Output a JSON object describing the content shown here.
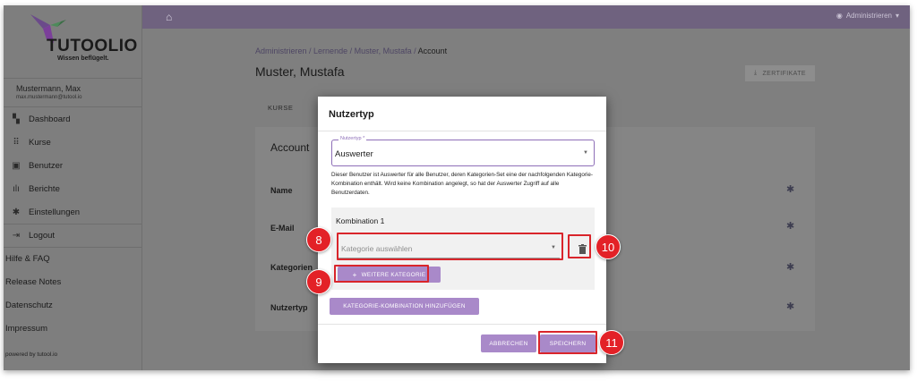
{
  "brand": {
    "name": "TUTOOLIO",
    "tagline": "Wissen beflügelt."
  },
  "user": {
    "name": "Mustermann, Max",
    "email": "max.mustermann@tutool.io"
  },
  "nav": [
    {
      "label": "Dashboard",
      "icon": "dashboard-icon"
    },
    {
      "label": "Kurse",
      "icon": "grid-icon"
    },
    {
      "label": "Benutzer",
      "icon": "user-icon"
    },
    {
      "label": "Berichte",
      "icon": "bar-chart-icon"
    },
    {
      "label": "Einstellungen",
      "icon": "gear-icon"
    },
    {
      "label": "Logout",
      "icon": "logout-icon"
    }
  ],
  "links": [
    "Hilfe & FAQ",
    "Release Notes",
    "Datenschutz",
    "Impressum"
  ],
  "powered": "powered by tutool.io",
  "topbar": {
    "admin_label": "Administrieren"
  },
  "breadcrumb": {
    "items": [
      "Administrieren",
      "Lernende",
      "Muster, Mustafa"
    ],
    "current": "Account"
  },
  "page_title": "Muster, Mustafa",
  "certificates_label": "ZERTIFIKATE",
  "tabs": [
    "KURSE"
  ],
  "account": {
    "title": "Account",
    "rows": [
      "Name",
      "E-Mail",
      "Kategorien",
      "Nutzertyp"
    ]
  },
  "dialog": {
    "title": "Nutzertyp",
    "select_label": "Nutzertyp *",
    "select_value": "Auswerter",
    "hint": "Dieser Benutzer ist Auswerter für alle Benutzer, deren Kategorien-Set eine der nachfolgenden Kategorie-Kombination enthält. Wird keine Kombination angelegt, so hat der Auswerter Zugriff auf alle Benutzerdaten.",
    "combination_title": "Kombination 1",
    "category_placeholder": "Kategorie auswählen",
    "more_category_label": "WEITERE KATEGORIE",
    "add_combination_label": "KATEGORIE-KOMBINATION HINZUFÜGEN",
    "cancel_label": "ABBRECHEN",
    "save_label": "SPEICHERN"
  },
  "markers": [
    "8",
    "9",
    "10",
    "11"
  ],
  "colors": {
    "accent": "#a989c9",
    "topbar": "#6f627f",
    "annotation": "#d9252b"
  }
}
